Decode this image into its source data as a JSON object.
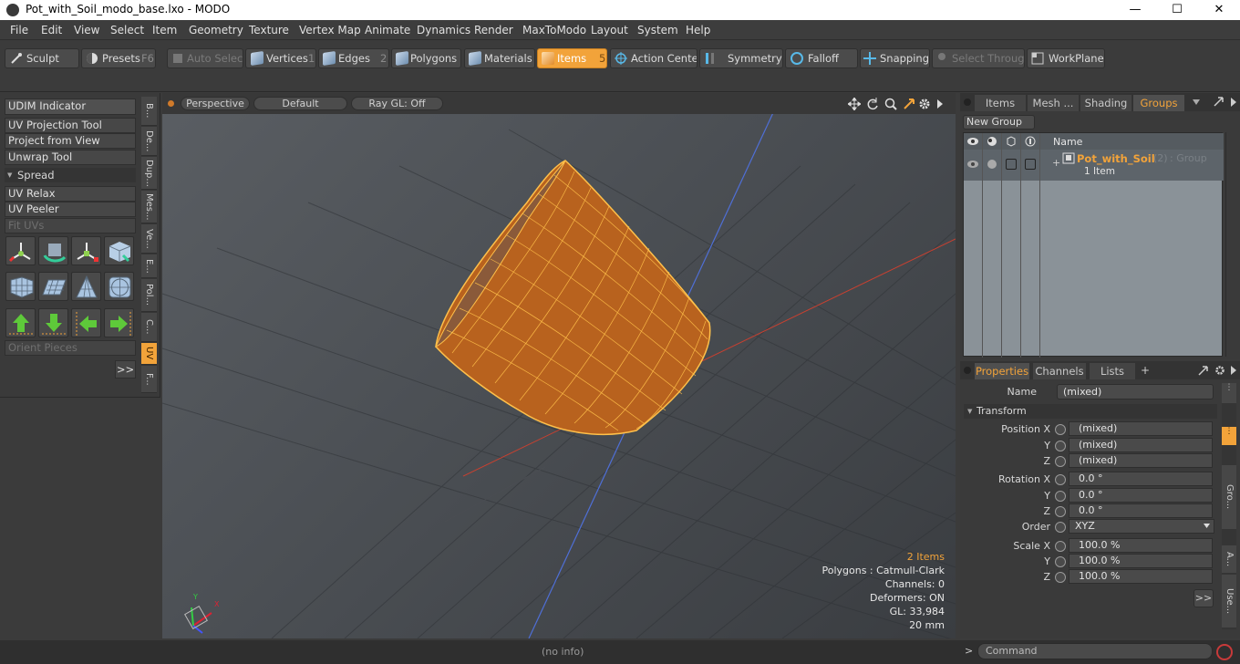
{
  "window": {
    "title": "Pot_with_Soil_modo_base.lxo - MODO",
    "minimize": "—",
    "maximize": "☐",
    "close": "✕"
  },
  "menu": [
    "File",
    "Edit",
    "View",
    "Select",
    "Item",
    "Geometry",
    "Texture",
    "Vertex Map",
    "Animate",
    "Dynamics",
    "Render",
    "MaxToModo",
    "Layout",
    "System",
    "Help"
  ],
  "toolbar": {
    "sculpt": "Sculpt",
    "presets": "Presets",
    "presets_key": "F6",
    "auto_select": "Auto Select",
    "vertices": "Vertices",
    "vertices_num": "1",
    "edges": "Edges",
    "edges_num": "2",
    "polygons": "Polygons",
    "materials": "Materials",
    "items": "Items",
    "items_num": "5",
    "action_center": "Action Center",
    "symmetry": "Symmetry",
    "falloff": "Falloff",
    "snapping": "Snapping",
    "select_through": "Select Through",
    "workplane": "WorkPlane"
  },
  "left": {
    "udim": "UDIM Indicator",
    "uv_projection": "UV Projection Tool",
    "project_view": "Project from View",
    "unwrap": "Unwrap Tool",
    "spread": "Spread",
    "uv_relax": "UV Relax",
    "uv_peeler": "UV Peeler",
    "fit_uvs": "Fit UVs",
    "orient": "Orient Pieces",
    "more": ">>"
  },
  "vtabs": [
    "B...",
    "De...",
    "Dup...",
    "Mes...",
    "Ve...",
    "E...",
    "Pol...",
    "C...",
    "UV",
    "F..."
  ],
  "viewport": {
    "perspective": "Perspective",
    "default": "Default",
    "raygl": "Ray GL: Off",
    "info_items": "2 Items",
    "info_polys": "Polygons : Catmull-Clark",
    "info_channels": "Channels: 0",
    "info_deformers": "Deformers: ON",
    "info_gl": "GL: 33,984",
    "info_scale": "20 mm",
    "axis_y": "Y",
    "axis_x": "X",
    "axis_z": "Z"
  },
  "status": {
    "info": "(no info)",
    "command_prefix": ">",
    "command_placeholder": "Command"
  },
  "groups": {
    "tabs": [
      "Items",
      "Mesh ...",
      "Shading",
      "Groups"
    ],
    "new_group": "New Group",
    "col_name": "Name",
    "group_name": "Pot_with_Soil",
    "group_count": "(2)",
    "group_type": ": Group",
    "group_items": "1 Item"
  },
  "properties": {
    "tabs": [
      "Properties",
      "Channels",
      "Lists"
    ],
    "plus": "+",
    "name_label": "Name",
    "name_value": "(mixed)",
    "transform": "Transform",
    "pos_x_label": "Position X",
    "pos_x": "(mixed)",
    "pos_y_label": "Y",
    "pos_y": "(mixed)",
    "pos_z_label": "Z",
    "pos_z": "(mixed)",
    "rot_x_label": "Rotation X",
    "rot_x": "0.0 °",
    "rot_y_label": "Y",
    "rot_y": "0.0 °",
    "rot_z_label": "Z",
    "rot_z": "0.0 °",
    "order_label": "Order",
    "order": "XYZ",
    "scale_x_label": "Scale X",
    "scale_x": "100.0 %",
    "scale_y_label": "Y",
    "scale_y": "100.0 %",
    "scale_z_label": "Z",
    "scale_z": "100.0 %",
    "more": ">>"
  },
  "side_tabs_right": [
    "Gro...",
    "A...",
    "Use..."
  ],
  "colors": {
    "accent": "#f2a33a",
    "pot": "#b8621e",
    "wire": "#ffc04a"
  }
}
